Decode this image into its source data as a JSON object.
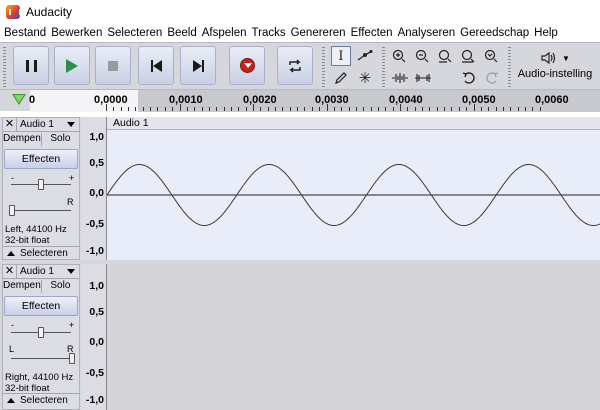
{
  "window": {
    "title": "Audacity"
  },
  "menu": [
    "Bestand",
    "Bewerken",
    "Selecteren",
    "Beeld",
    "Afspelen",
    "Tracks",
    "Genereren",
    "Effecten",
    "Analyseren",
    "Gereedschap",
    "Help"
  ],
  "toolbar": {
    "transport": [
      "pause-icon",
      "play-icon",
      "stop-icon",
      "skip-to-start-icon",
      "skip-to-end-icon",
      "record-icon",
      "loop-icon"
    ],
    "audio_setup_label": "Audio-instelling",
    "audio_setup_icon": "speaker-icon"
  },
  "timeline": {
    "ticks": [
      "0,0000",
      "0,0010",
      "0,0020",
      "0,0030",
      "0,0040",
      "0,0050",
      "0,0060"
    ]
  },
  "tracks": [
    {
      "name": "Audio 1",
      "mute_label": "Dempen",
      "solo_label": "Solo",
      "effects_label": "Effecten",
      "gain_minus": "-",
      "gain_plus": "+",
      "pan_left": "L",
      "pan_right": "R",
      "info_line1": "Left, 44100 Hz",
      "info_line2": "32-bit float",
      "select_label": "Selecteren",
      "clip_name": "Audio 1",
      "scale": [
        "1,0",
        "0,5",
        "0,0",
        "-0,5",
        "-1,0"
      ],
      "selected": true
    },
    {
      "name": "Audio 1",
      "mute_label": "Dempen",
      "solo_label": "Solo",
      "effects_label": "Effecten",
      "gain_minus": "-",
      "gain_plus": "+",
      "pan_left": "L",
      "pan_right": "R",
      "info_line1": "Right, 44100 Hz",
      "info_line2": "32-bit float",
      "select_label": "Selecteren",
      "scale": [
        "1,0",
        "0,5",
        "0,0",
        "-0,5",
        "-1,0"
      ],
      "selected": false
    }
  ],
  "waveform": {
    "cycles_visible": 3.8,
    "amplitude": 0.5,
    "color": "#3a3a3a"
  }
}
